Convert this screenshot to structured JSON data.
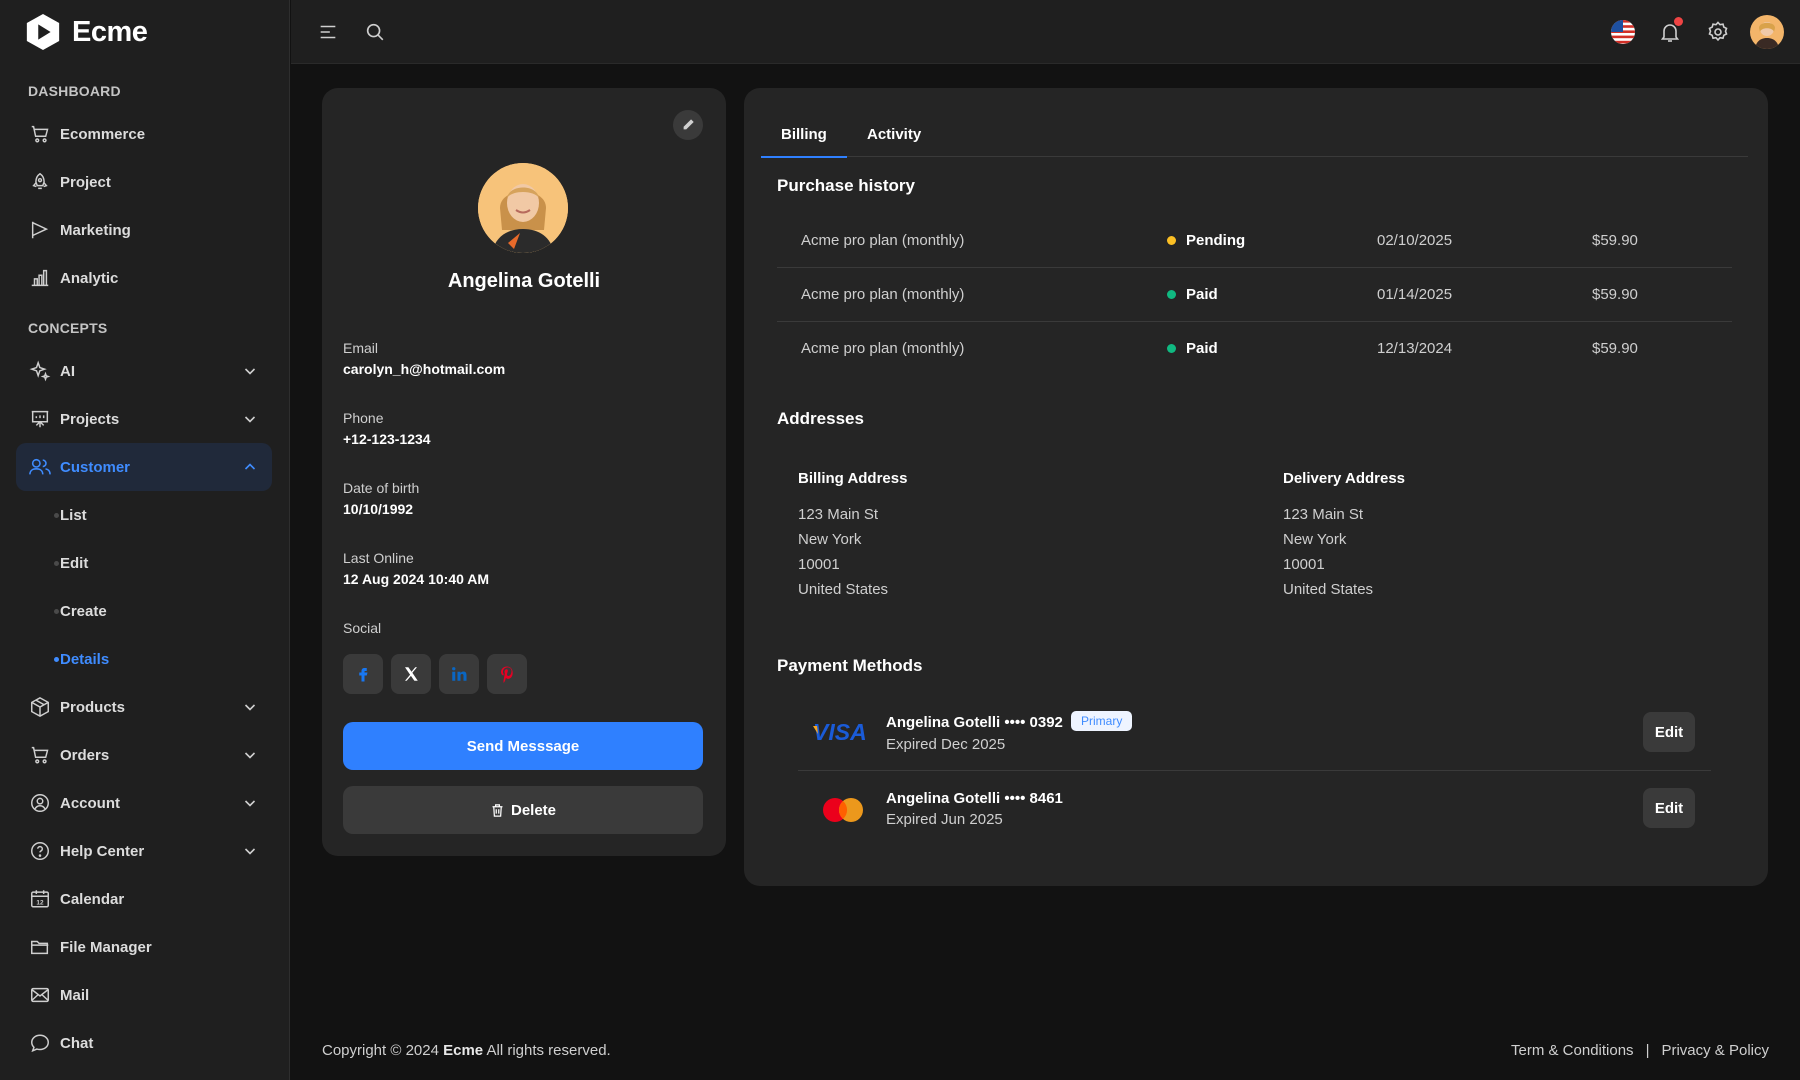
{
  "app": {
    "name": "Ecme"
  },
  "sidebar": {
    "sections": [
      {
        "title": "DASHBOARD"
      },
      {
        "title": "CONCEPTS"
      }
    ],
    "dashboard_items": [
      {
        "label": "Ecommerce",
        "icon": "cart-icon"
      },
      {
        "label": "Project",
        "icon": "rocket-icon"
      },
      {
        "label": "Marketing",
        "icon": "flag-icon"
      },
      {
        "label": "Analytic",
        "icon": "bar-chart-icon"
      }
    ],
    "concept_items": [
      {
        "label": "AI",
        "icon": "sparkle-icon",
        "expandable": true
      },
      {
        "label": "Projects",
        "icon": "presentation-icon",
        "expandable": true
      },
      {
        "label": "Customer",
        "icon": "users-icon",
        "expandable": true,
        "expanded": true,
        "active": true
      },
      {
        "label": "Products",
        "icon": "box-icon",
        "expandable": true
      },
      {
        "label": "Orders",
        "icon": "cart-icon",
        "expandable": true
      },
      {
        "label": "Account",
        "icon": "user-circle-icon",
        "expandable": true
      },
      {
        "label": "Help Center",
        "icon": "help-icon",
        "expandable": true
      },
      {
        "label": "Calendar",
        "icon": "calendar-icon"
      },
      {
        "label": "File Manager",
        "icon": "folder-icon"
      },
      {
        "label": "Mail",
        "icon": "mail-icon"
      },
      {
        "label": "Chat",
        "icon": "chat-icon"
      }
    ],
    "customer_sub": [
      {
        "label": "List"
      },
      {
        "label": "Edit"
      },
      {
        "label": "Create"
      },
      {
        "label": "Details",
        "active": true
      }
    ],
    "calendar_icon_text": "12"
  },
  "topbar": {
    "icons": [
      "menu-icon",
      "search-icon",
      "us-flag-icon",
      "bell-icon",
      "gear-icon",
      "avatar"
    ]
  },
  "profile": {
    "name": "Angelina Gotelli",
    "fields": [
      {
        "label": "Email",
        "value": "carolyn_h@hotmail.com"
      },
      {
        "label": "Phone",
        "value": "+12-123-1234"
      },
      {
        "label": "Date of birth",
        "value": "10/10/1992"
      },
      {
        "label": "Last Online",
        "value": "12 Aug 2024 10:40 AM"
      }
    ],
    "social_label": "Social",
    "social": [
      {
        "name": "facebook",
        "glyph": "f",
        "color": "#1877f2"
      },
      {
        "name": "x",
        "glyph": "X",
        "color": "#ffffff"
      },
      {
        "name": "linkedin",
        "glyph": "in",
        "color": "#0a66c2"
      },
      {
        "name": "pinterest",
        "glyph": "P",
        "color": "#e60023"
      }
    ],
    "send_label": "Send Messsage",
    "delete_label": "Delete"
  },
  "tabs": [
    {
      "label": "Billing",
      "active": true
    },
    {
      "label": "Activity"
    }
  ],
  "purchase": {
    "title": "Purchase history",
    "rows": [
      {
        "item": "Acme pro plan (monthly)",
        "status": "Pending",
        "status_color": "#fbbf24",
        "date": "02/10/2025",
        "amount": "$59.90"
      },
      {
        "item": "Acme pro plan (monthly)",
        "status": "Paid",
        "status_color": "#10b981",
        "date": "01/14/2025",
        "amount": "$59.90"
      },
      {
        "item": "Acme pro plan (monthly)",
        "status": "Paid",
        "status_color": "#10b981",
        "date": "12/13/2024",
        "amount": "$59.90"
      }
    ]
  },
  "addresses": {
    "title": "Addresses",
    "billing": {
      "title": "Billing Address",
      "lines": [
        "123 Main St",
        "New York",
        "10001",
        "United States"
      ]
    },
    "delivery": {
      "title": "Delivery Address",
      "lines": [
        "123 Main St",
        "New York",
        "10001",
        "United States"
      ]
    }
  },
  "payment": {
    "title": "Payment Methods",
    "methods": [
      {
        "brand": "VISA",
        "name": "Angelina Gotelli •••• 0392",
        "expiry": "Expired Dec 2025",
        "badge": "Primary",
        "edit": "Edit"
      },
      {
        "brand": "mastercard",
        "name": "Angelina Gotelli •••• 8461",
        "expiry": "Expired Jun 2025",
        "edit": "Edit"
      }
    ]
  },
  "footer": {
    "copyright_prefix": "Copyright © 2024 ",
    "copyright_brand": "Ecme",
    "copyright_suffix": " All rights reserved.",
    "links": [
      "Term & Conditions",
      "|",
      "Privacy & Policy"
    ]
  },
  "colors": {
    "accent": "#2f80ff",
    "pending": "#fbbf24",
    "paid": "#10b981"
  }
}
